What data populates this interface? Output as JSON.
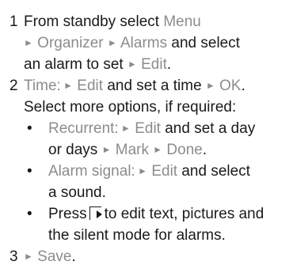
{
  "steps": [
    {
      "number": "1",
      "lines": [
        {
          "plain1": "From standby select ",
          "ui1": "Menu"
        },
        {
          "arrow1": "►",
          "ui1": " Organizer ",
          "arrow2": "►",
          "ui2": " Alarms",
          "plain2": " and select"
        },
        {
          "plain1": "an alarm to set ",
          "arrow1": "►",
          "ui1": " Edit",
          "plain2": "."
        }
      ]
    },
    {
      "number": "2",
      "lines": [
        {
          "ui1": "Time:",
          "arrow1": " ►",
          "ui2": " Edit",
          "plain1": " and set a time ",
          "arrow2": "►",
          "ui3": " OK",
          "plain2": "."
        },
        {
          "plain1": "Select more options, if required:"
        }
      ],
      "bullets": [
        {
          "lines": [
            {
              "ui1": "Recurrent:",
              "arrow1": " ►",
              "ui2": " Edit",
              "plain1": " and set a day"
            },
            {
              "plain1": "or days ",
              "arrow1": "►",
              "ui1": " Mark ",
              "arrow2": "►",
              "ui2": " Done",
              "plain2": "."
            }
          ]
        },
        {
          "lines": [
            {
              "ui1": "Alarm signal:",
              "arrow1": " ►",
              "ui2": " Edit",
              "plain1": " and select"
            },
            {
              "plain1": "a sound."
            }
          ]
        },
        {
          "lines": [
            {
              "plain1": "Press",
              "icon": "options-key-icon",
              "plain2": "to edit text, pictures and"
            },
            {
              "plain1": "the silent mode for alarms."
            }
          ]
        }
      ]
    },
    {
      "number": "3",
      "lines": [
        {
          "arrow1": "►",
          "ui1": " Save",
          "plain1": "."
        }
      ]
    }
  ],
  "bullet_glyph": "•"
}
